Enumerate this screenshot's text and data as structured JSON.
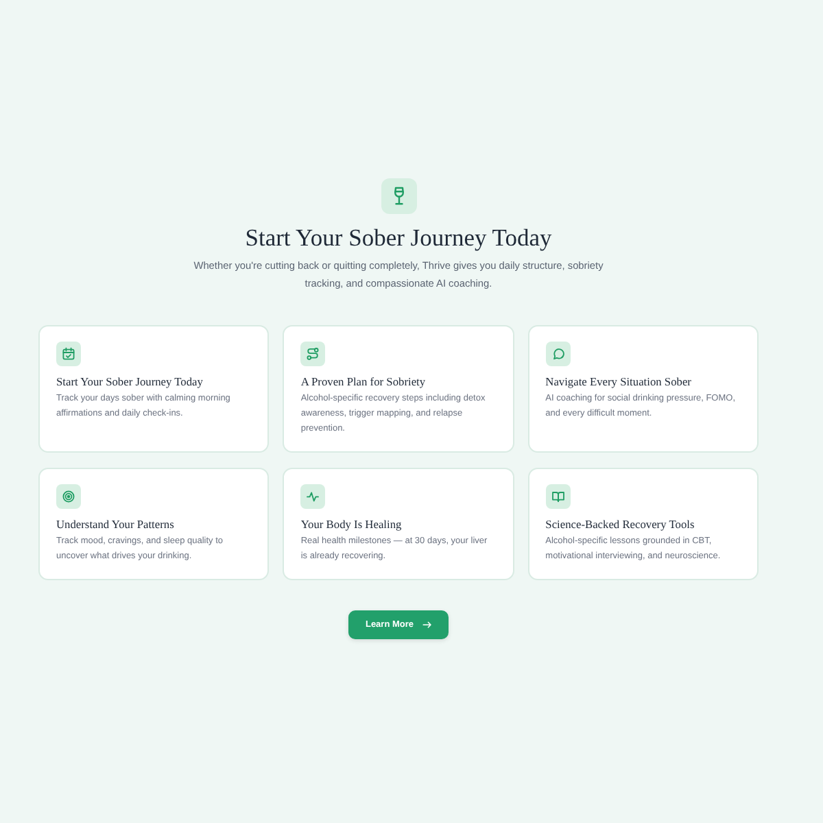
{
  "hero": {
    "title": "Start Your Sober Journey Today",
    "subtitle": "Whether you're cutting back or quitting completely, Thrive gives you daily structure, sobriety tracking, and compassionate AI coaching."
  },
  "features": [
    {
      "title": "Start Your Sober Journey Today",
      "description": "Track your days sober with calming morning affirmations and daily check-ins."
    },
    {
      "title": "A Proven Plan for Sobriety",
      "description": "Alcohol-specific recovery steps including detox awareness, trigger mapping, and relapse prevention."
    },
    {
      "title": "Navigate Every Situation Sober",
      "description": "AI coaching for social drinking pressure, FOMO, and every difficult moment."
    },
    {
      "title": "Understand Your Patterns",
      "description": "Track mood, cravings, and sleep quality to uncover what drives your drinking."
    },
    {
      "title": "Your Body Is Healing",
      "description": "Real health milestones — at 30 days, your liver is already recovering."
    },
    {
      "title": "Science-Backed Recovery Tools",
      "description": "Alcohol-specific lessons grounded in CBT, motivational interviewing, and neuroscience."
    }
  ],
  "cta": {
    "label": "Learn More"
  }
}
